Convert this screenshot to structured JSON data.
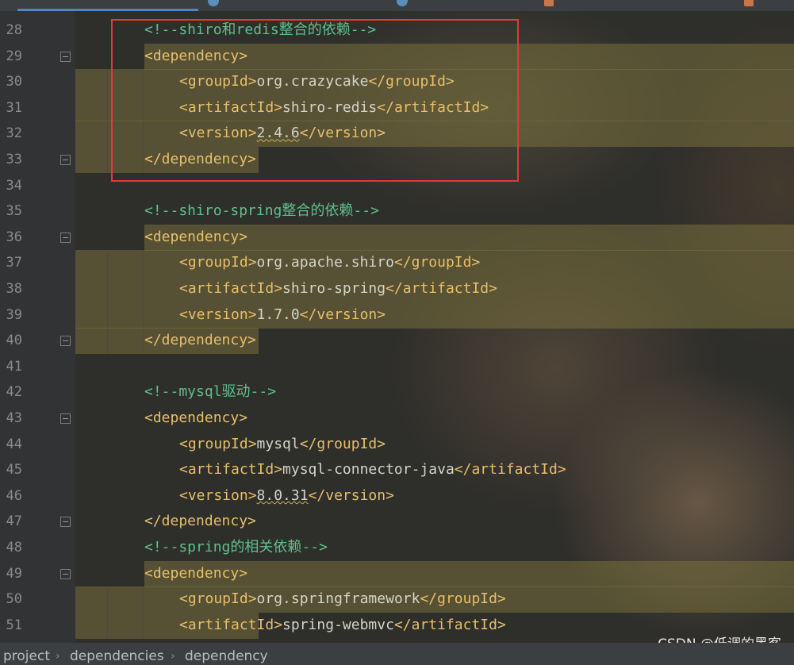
{
  "breadcrumb": [
    "project",
    "dependencies",
    "dependency"
  ],
  "watermark": "CSDN @低调的黑客",
  "lines": [
    {
      "num": "28",
      "fold": false,
      "parts": [
        {
          "t": "<!--shiro和redis整合的依赖-->",
          "c": "c-comment"
        }
      ],
      "indent": 182
    },
    {
      "num": "29",
      "fold": true,
      "parts": [
        {
          "t": "<dependency>",
          "c": "c-tag"
        }
      ],
      "indent": 182
    },
    {
      "num": "30",
      "fold": false,
      "parts": [
        {
          "t": "<groupId>",
          "c": "c-tag"
        },
        {
          "t": "org.crazycake",
          "c": "c-text"
        },
        {
          "t": "</groupId>",
          "c": "c-tag"
        }
      ],
      "indent": 226
    },
    {
      "num": "31",
      "fold": false,
      "parts": [
        {
          "t": "<artifactId>",
          "c": "c-tag"
        },
        {
          "t": "shiro-redis",
          "c": "c-text"
        },
        {
          "t": "</artifactId>",
          "c": "c-tag"
        }
      ],
      "indent": 226
    },
    {
      "num": "32",
      "fold": false,
      "parts": [
        {
          "t": "<version>",
          "c": "c-tag"
        },
        {
          "t": "2.4.6",
          "c": "c-text c-warn"
        },
        {
          "t": "</version>",
          "c": "c-tag"
        }
      ],
      "indent": 226
    },
    {
      "num": "33",
      "fold": true,
      "parts": [
        {
          "t": "</dependency>",
          "c": "c-tag"
        }
      ],
      "indent": 182
    },
    {
      "num": "34",
      "fold": false,
      "parts": [],
      "indent": 182
    },
    {
      "num": "35",
      "fold": false,
      "parts": [
        {
          "t": "<!--shiro-spring整合的依赖-->",
          "c": "c-comment"
        }
      ],
      "indent": 182
    },
    {
      "num": "36",
      "fold": true,
      "parts": [
        {
          "t": "<dependency>",
          "c": "c-tag"
        }
      ],
      "indent": 182
    },
    {
      "num": "37",
      "fold": false,
      "parts": [
        {
          "t": "<groupId>",
          "c": "c-tag"
        },
        {
          "t": "org.apache.shiro",
          "c": "c-text"
        },
        {
          "t": "</groupId>",
          "c": "c-tag"
        }
      ],
      "indent": 226
    },
    {
      "num": "38",
      "fold": false,
      "parts": [
        {
          "t": "<artifactId>",
          "c": "c-tag"
        },
        {
          "t": "shiro-spring",
          "c": "c-text"
        },
        {
          "t": "</artifactId>",
          "c": "c-tag"
        }
      ],
      "indent": 226
    },
    {
      "num": "39",
      "fold": false,
      "parts": [
        {
          "t": "<version>",
          "c": "c-tag"
        },
        {
          "t": "1.7.0",
          "c": "c-text"
        },
        {
          "t": "</version>",
          "c": "c-tag"
        }
      ],
      "indent": 226
    },
    {
      "num": "40",
      "fold": true,
      "parts": [
        {
          "t": "</dependency>",
          "c": "c-tag"
        }
      ],
      "indent": 182
    },
    {
      "num": "41",
      "fold": false,
      "parts": [],
      "indent": 182
    },
    {
      "num": "42",
      "fold": false,
      "parts": [
        {
          "t": "<!--mysql驱动-->",
          "c": "c-comment"
        }
      ],
      "indent": 182
    },
    {
      "num": "43",
      "fold": true,
      "parts": [
        {
          "t": "<dependency>",
          "c": "c-tag"
        }
      ],
      "indent": 182
    },
    {
      "num": "44",
      "fold": false,
      "parts": [
        {
          "t": "<groupId>",
          "c": "c-tag"
        },
        {
          "t": "mysql",
          "c": "c-text"
        },
        {
          "t": "</groupId>",
          "c": "c-tag"
        }
      ],
      "indent": 226
    },
    {
      "num": "45",
      "fold": false,
      "parts": [
        {
          "t": "<artifactId>",
          "c": "c-tag"
        },
        {
          "t": "mysql-connector-java",
          "c": "c-text"
        },
        {
          "t": "</artifactId>",
          "c": "c-tag"
        }
      ],
      "indent": 226
    },
    {
      "num": "46",
      "fold": false,
      "parts": [
        {
          "t": "<version>",
          "c": "c-tag"
        },
        {
          "t": "8.0.31",
          "c": "c-text c-warn"
        },
        {
          "t": "</version>",
          "c": "c-tag"
        }
      ],
      "indent": 226
    },
    {
      "num": "47",
      "fold": true,
      "parts": [
        {
          "t": "</dependency>",
          "c": "c-tag"
        }
      ],
      "indent": 182
    },
    {
      "num": "48",
      "fold": false,
      "parts": [
        {
          "t": "<!--spring的相关依赖-->",
          "c": "c-comment"
        }
      ],
      "indent": 182
    },
    {
      "num": "49",
      "fold": true,
      "parts": [
        {
          "t": "<dependency>",
          "c": "c-tag"
        }
      ],
      "indent": 182
    },
    {
      "num": "50",
      "fold": false,
      "parts": [
        {
          "t": "<groupId>",
          "c": "c-tag"
        },
        {
          "t": "org.springframework",
          "c": "c-text"
        },
        {
          "t": "</groupId>",
          "c": "c-tag"
        }
      ],
      "indent": 226
    },
    {
      "num": "51",
      "fold": false,
      "parts": [
        {
          "t": "<artifactId>",
          "c": "c-tag"
        },
        {
          "t": "spring-webmvc",
          "c": "c-text"
        },
        {
          "t": "</artifactId>",
          "c": "c-tag"
        }
      ],
      "indent": 226
    }
  ]
}
